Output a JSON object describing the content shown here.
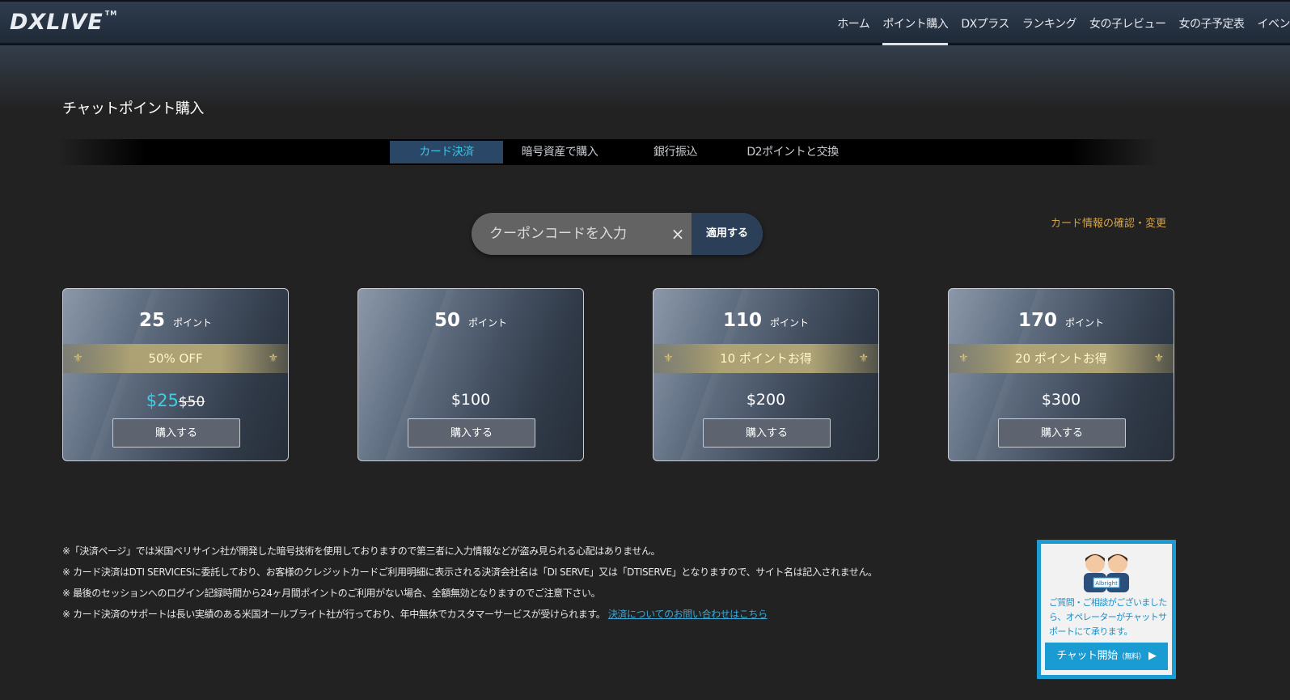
{
  "header": {
    "logo": "DXLIVE",
    "logo_tm": "TM",
    "nav": [
      "ホーム",
      "ポイント購入",
      "DXプラス",
      "ランキング",
      "女の子レビュー",
      "女の子予定表",
      "イベン"
    ]
  },
  "page": {
    "title": "チャットポイント購入"
  },
  "tabs": [
    "カード決済",
    "暗号資産で購入",
    "銀行振込",
    "D2ポイントと交換"
  ],
  "coupon": {
    "placeholder": "クーポンコードを入力",
    "clear": "×",
    "apply_label": "適用する"
  },
  "card_info_link": "カード情報の確認・変更",
  "packages": [
    {
      "points": "25",
      "unit": "ポイント",
      "badge": "50% OFF",
      "price_sale": "$25",
      "price_orig": "$50",
      "buy_label": "購入する"
    },
    {
      "points": "50",
      "unit": "ポイント",
      "price": "$100",
      "buy_label": "購入する"
    },
    {
      "points": "110",
      "unit": "ポイント",
      "badge": "10 ポイントお得",
      "price": "$200",
      "buy_label": "購入する"
    },
    {
      "points": "170",
      "unit": "ポイント",
      "badge": "20 ポイントお得",
      "price": "$300",
      "buy_label": "購入する"
    }
  ],
  "notes": [
    "※「決済ページ」では米国ベリサイン社が開発した暗号技術を使用しておりますので第三者に入力情報などが盗み見られる心配はありません。",
    "※ カード決済はDTI SERVICESに委託しており、お客様のクレジットカードご利用明細に表示される決済会社名は「DI SERVE」又は「DTISERVE」となりますので、サイト名は記入されません。",
    "※ 最後のセッションへのログイン記録時間から24ヶ月間ポイントのご利用がない場合、全額無効となりますのでご注意下さい。",
    "※ カード決済のサポートは長い実績のある米国オールブライト社が行っており、年中無休でカスタマーサービスが受けられます。"
  ],
  "notes_link": "決済についてのお問い合わせはこちら",
  "support": {
    "badge": "Albright",
    "text": "ご質問・ご相談がございましたら、オペレーターがチャットサポートにて承ります。",
    "button_label": "チャット開始",
    "button_sub": "（無料）",
    "button_arrow": "▶"
  }
}
